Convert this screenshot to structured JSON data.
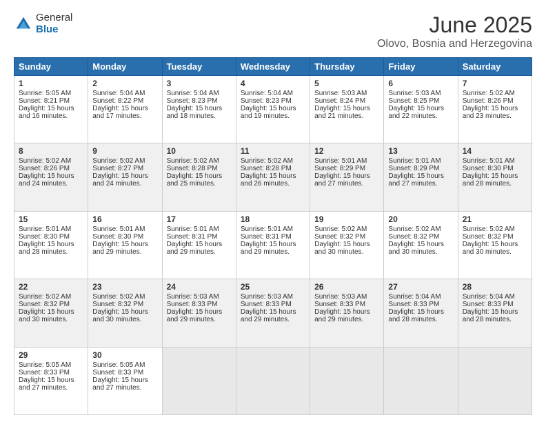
{
  "logo": {
    "general": "General",
    "blue": "Blue",
    "icon_color": "#1a6faf"
  },
  "header": {
    "month": "June 2025",
    "location": "Olovo, Bosnia and Herzegovina"
  },
  "weekdays": [
    "Sunday",
    "Monday",
    "Tuesday",
    "Wednesday",
    "Thursday",
    "Friday",
    "Saturday"
  ],
  "rows": [
    [
      {
        "day": "1",
        "sunrise": "Sunrise: 5:05 AM",
        "sunset": "Sunset: 8:21 PM",
        "daylight": "Daylight: 15 hours and 16 minutes."
      },
      {
        "day": "2",
        "sunrise": "Sunrise: 5:04 AM",
        "sunset": "Sunset: 8:22 PM",
        "daylight": "Daylight: 15 hours and 17 minutes."
      },
      {
        "day": "3",
        "sunrise": "Sunrise: 5:04 AM",
        "sunset": "Sunset: 8:23 PM",
        "daylight": "Daylight: 15 hours and 18 minutes."
      },
      {
        "day": "4",
        "sunrise": "Sunrise: 5:04 AM",
        "sunset": "Sunset: 8:23 PM",
        "daylight": "Daylight: 15 hours and 19 minutes."
      },
      {
        "day": "5",
        "sunrise": "Sunrise: 5:03 AM",
        "sunset": "Sunset: 8:24 PM",
        "daylight": "Daylight: 15 hours and 21 minutes."
      },
      {
        "day": "6",
        "sunrise": "Sunrise: 5:03 AM",
        "sunset": "Sunset: 8:25 PM",
        "daylight": "Daylight: 15 hours and 22 minutes."
      },
      {
        "day": "7",
        "sunrise": "Sunrise: 5:02 AM",
        "sunset": "Sunset: 8:26 PM",
        "daylight": "Daylight: 15 hours and 23 minutes."
      }
    ],
    [
      {
        "day": "8",
        "sunrise": "Sunrise: 5:02 AM",
        "sunset": "Sunset: 8:26 PM",
        "daylight": "Daylight: 15 hours and 24 minutes."
      },
      {
        "day": "9",
        "sunrise": "Sunrise: 5:02 AM",
        "sunset": "Sunset: 8:27 PM",
        "daylight": "Daylight: 15 hours and 24 minutes."
      },
      {
        "day": "10",
        "sunrise": "Sunrise: 5:02 AM",
        "sunset": "Sunset: 8:28 PM",
        "daylight": "Daylight: 15 hours and 25 minutes."
      },
      {
        "day": "11",
        "sunrise": "Sunrise: 5:02 AM",
        "sunset": "Sunset: 8:28 PM",
        "daylight": "Daylight: 15 hours and 26 minutes."
      },
      {
        "day": "12",
        "sunrise": "Sunrise: 5:01 AM",
        "sunset": "Sunset: 8:29 PM",
        "daylight": "Daylight: 15 hours and 27 minutes."
      },
      {
        "day": "13",
        "sunrise": "Sunrise: 5:01 AM",
        "sunset": "Sunset: 8:29 PM",
        "daylight": "Daylight: 15 hours and 27 minutes."
      },
      {
        "day": "14",
        "sunrise": "Sunrise: 5:01 AM",
        "sunset": "Sunset: 8:30 PM",
        "daylight": "Daylight: 15 hours and 28 minutes."
      }
    ],
    [
      {
        "day": "15",
        "sunrise": "Sunrise: 5:01 AM",
        "sunset": "Sunset: 8:30 PM",
        "daylight": "Daylight: 15 hours and 28 minutes."
      },
      {
        "day": "16",
        "sunrise": "Sunrise: 5:01 AM",
        "sunset": "Sunset: 8:30 PM",
        "daylight": "Daylight: 15 hours and 29 minutes."
      },
      {
        "day": "17",
        "sunrise": "Sunrise: 5:01 AM",
        "sunset": "Sunset: 8:31 PM",
        "daylight": "Daylight: 15 hours and 29 minutes."
      },
      {
        "day": "18",
        "sunrise": "Sunrise: 5:01 AM",
        "sunset": "Sunset: 8:31 PM",
        "daylight": "Daylight: 15 hours and 29 minutes."
      },
      {
        "day": "19",
        "sunrise": "Sunrise: 5:02 AM",
        "sunset": "Sunset: 8:32 PM",
        "daylight": "Daylight: 15 hours and 30 minutes."
      },
      {
        "day": "20",
        "sunrise": "Sunrise: 5:02 AM",
        "sunset": "Sunset: 8:32 PM",
        "daylight": "Daylight: 15 hours and 30 minutes."
      },
      {
        "day": "21",
        "sunrise": "Sunrise: 5:02 AM",
        "sunset": "Sunset: 8:32 PM",
        "daylight": "Daylight: 15 hours and 30 minutes."
      }
    ],
    [
      {
        "day": "22",
        "sunrise": "Sunrise: 5:02 AM",
        "sunset": "Sunset: 8:32 PM",
        "daylight": "Daylight: 15 hours and 30 minutes."
      },
      {
        "day": "23",
        "sunrise": "Sunrise: 5:02 AM",
        "sunset": "Sunset: 8:32 PM",
        "daylight": "Daylight: 15 hours and 30 minutes."
      },
      {
        "day": "24",
        "sunrise": "Sunrise: 5:03 AM",
        "sunset": "Sunset: 8:33 PM",
        "daylight": "Daylight: 15 hours and 29 minutes."
      },
      {
        "day": "25",
        "sunrise": "Sunrise: 5:03 AM",
        "sunset": "Sunset: 8:33 PM",
        "daylight": "Daylight: 15 hours and 29 minutes."
      },
      {
        "day": "26",
        "sunrise": "Sunrise: 5:03 AM",
        "sunset": "Sunset: 8:33 PM",
        "daylight": "Daylight: 15 hours and 29 minutes."
      },
      {
        "day": "27",
        "sunrise": "Sunrise: 5:04 AM",
        "sunset": "Sunset: 8:33 PM",
        "daylight": "Daylight: 15 hours and 28 minutes."
      },
      {
        "day": "28",
        "sunrise": "Sunrise: 5:04 AM",
        "sunset": "Sunset: 8:33 PM",
        "daylight": "Daylight: 15 hours and 28 minutes."
      }
    ],
    [
      {
        "day": "29",
        "sunrise": "Sunrise: 5:05 AM",
        "sunset": "Sunset: 8:33 PM",
        "daylight": "Daylight: 15 hours and 27 minutes."
      },
      {
        "day": "30",
        "sunrise": "Sunrise: 5:05 AM",
        "sunset": "Sunset: 8:33 PM",
        "daylight": "Daylight: 15 hours and 27 minutes."
      },
      {
        "day": "",
        "sunrise": "",
        "sunset": "",
        "daylight": ""
      },
      {
        "day": "",
        "sunrise": "",
        "sunset": "",
        "daylight": ""
      },
      {
        "day": "",
        "sunrise": "",
        "sunset": "",
        "daylight": ""
      },
      {
        "day": "",
        "sunrise": "",
        "sunset": "",
        "daylight": ""
      },
      {
        "day": "",
        "sunrise": "",
        "sunset": "",
        "daylight": ""
      }
    ]
  ]
}
